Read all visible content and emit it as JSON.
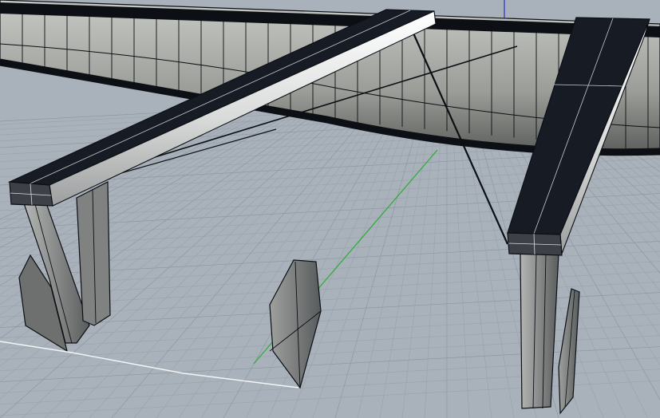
{
  "viewport": {
    "view_mode": "perspective",
    "display_mode": "shaded",
    "grid_visible": true,
    "colors": {
      "background": "#a9b1ba",
      "grid_minor": "#9ba3ad",
      "grid_major": "#8e97a2",
      "axis_y": "#2fae3a",
      "axis_z": "#3438c8",
      "edge": "#0c0f14",
      "dark_face": "#161b24",
      "light_face": "#e9ebea",
      "shadow_face": "#5e6163"
    }
  },
  "scene": {
    "objects": [
      {
        "name": "hull-curved-wall"
      },
      {
        "name": "left-beam"
      },
      {
        "name": "right-beam"
      },
      {
        "name": "left-support-leg"
      },
      {
        "name": "right-support-leg"
      },
      {
        "name": "center-fin"
      },
      {
        "name": "right-fin"
      },
      {
        "name": "tension-cable-1"
      },
      {
        "name": "tension-cable-2"
      },
      {
        "name": "tension-cable-3"
      }
    ]
  }
}
